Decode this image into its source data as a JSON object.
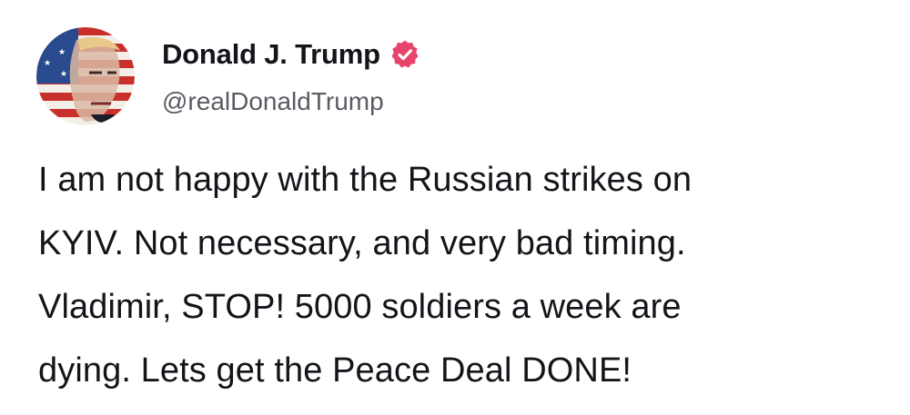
{
  "post": {
    "author": {
      "display_name": "Donald J. Trump",
      "handle": "@realDonaldTrump",
      "verified": true,
      "avatar_icon": "flag-portrait-avatar"
    },
    "body_lines": [
      "I am not happy with the Russian strikes on",
      "KYIV. Not necessary, and very bad timing.",
      "Vladimir, STOP! 5000 soldiers a week are",
      "dying. Lets get the Peace Deal DONE!"
    ]
  },
  "colors": {
    "verified_badge": "#e8436b",
    "handle_text": "#5c5a62",
    "body_text": "#16141a"
  }
}
